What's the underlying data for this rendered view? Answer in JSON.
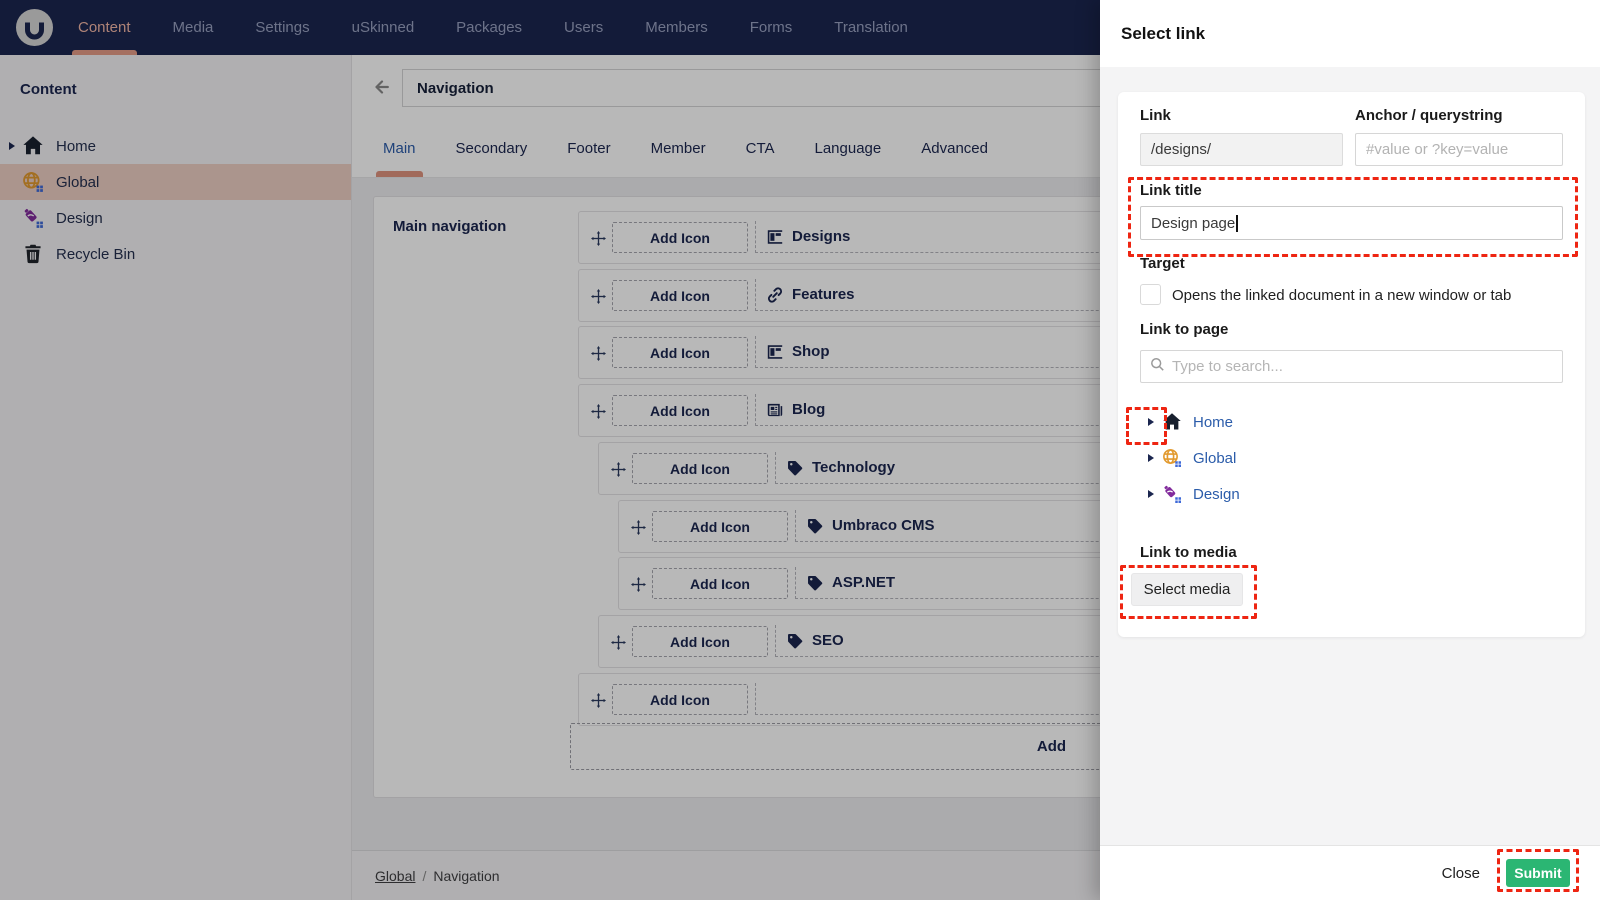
{
  "topnav": {
    "items": [
      {
        "label": "Content",
        "active": true
      },
      {
        "label": "Media",
        "active": false
      },
      {
        "label": "Settings",
        "active": false
      },
      {
        "label": "uSkinned",
        "active": false
      },
      {
        "label": "Packages",
        "active": false
      },
      {
        "label": "Users",
        "active": false
      },
      {
        "label": "Members",
        "active": false
      },
      {
        "label": "Forms",
        "active": false
      },
      {
        "label": "Translation",
        "active": false
      }
    ]
  },
  "sidebar": {
    "title": "Content",
    "items": [
      {
        "label": "Home",
        "icon": "home-icon",
        "has_arrow": true,
        "selected": false
      },
      {
        "label": "Global",
        "icon": "globe-icon",
        "has_arrow": false,
        "selected": true
      },
      {
        "label": "Design",
        "icon": "design-icon",
        "has_arrow": false,
        "selected": false
      },
      {
        "label": "Recycle Bin",
        "icon": "trash-icon",
        "has_arrow": false,
        "selected": false
      }
    ]
  },
  "editor": {
    "title_value": "Navigation",
    "tabs": [
      {
        "label": "Main",
        "active": true
      },
      {
        "label": "Secondary",
        "active": false
      },
      {
        "label": "Footer",
        "active": false
      },
      {
        "label": "Member",
        "active": false
      },
      {
        "label": "CTA",
        "active": false
      },
      {
        "label": "Language",
        "active": false
      },
      {
        "label": "Advanced",
        "active": false
      }
    ],
    "property_label": "Main navigation",
    "add_icon_label": "Add Icon",
    "add_label": "Add",
    "rows": [
      {
        "label": "Designs",
        "icon": "layout-icon",
        "depth": 0
      },
      {
        "label": "Features",
        "icon": "link-icon",
        "depth": 0
      },
      {
        "label": "Shop",
        "icon": "layout-icon",
        "depth": 0
      },
      {
        "label": "Blog",
        "icon": "news-icon",
        "depth": 0
      },
      {
        "label": "Technology",
        "icon": "tag-icon",
        "depth": 1
      },
      {
        "label": "Umbraco CMS",
        "icon": "tag-icon",
        "depth": 2
      },
      {
        "label": "ASP.NET",
        "icon": "tag-icon",
        "depth": 2
      },
      {
        "label": "SEO",
        "icon": "tag-icon",
        "depth": 1
      },
      {
        "label": "",
        "icon": "",
        "depth": 0
      }
    ],
    "breadcrumb": {
      "parent": "Global",
      "separator": "/",
      "current": "Navigation"
    }
  },
  "dialog": {
    "title": "Select link",
    "link": {
      "label": "Link",
      "value": "/designs/"
    },
    "anchor": {
      "label": "Anchor / querystring",
      "placeholder": "#value or ?key=value"
    },
    "link_title": {
      "label": "Link title",
      "value": "Design page"
    },
    "target": {
      "label": "Target",
      "checkbox_text": "Opens the linked document in a new window or tab",
      "checked": false
    },
    "link_to_page": {
      "label": "Link to page",
      "search_placeholder": "Type to search...",
      "tree": [
        {
          "label": "Home",
          "icon": "home-icon"
        },
        {
          "label": "Global",
          "icon": "globe-icon"
        },
        {
          "label": "Design",
          "icon": "design-icon"
        }
      ]
    },
    "link_to_media": {
      "label": "Link to media",
      "button_label": "Select media"
    },
    "footer": {
      "close_label": "Close",
      "submit_label": "Submit"
    }
  },
  "colors": {
    "nav_bg": "#1b264f",
    "active_salmon": "#f2b6a6",
    "selected_row_pink": "#eecfc4",
    "link_blue": "#2b5caa",
    "submit_green": "#2bb673",
    "annotation_red": "#ee2512"
  }
}
